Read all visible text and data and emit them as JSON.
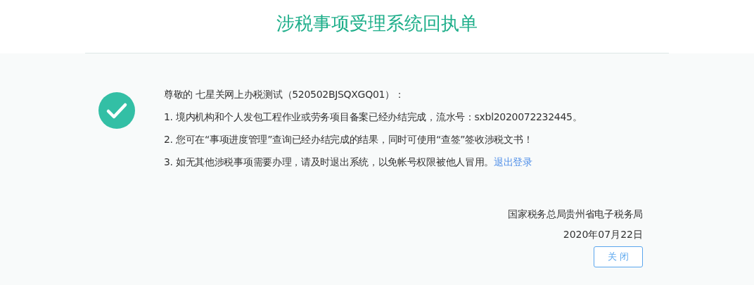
{
  "title": "涉税事项受理系统回执单",
  "greeting": "尊敬的 七星关网上办税测试（520502BJSQXGQ01）：",
  "items": [
    {
      "text": "1. 境内机构和个人发包工程作业或劳务项目备案已经办结完成，流水号：sxbl2020072232445。"
    },
    {
      "text": "2. 您可在“事项进度管理”查询已经办结完成的结果，同时可使用“查签”签收涉税文书！"
    },
    {
      "text": "3. 如无其他涉税事项需要办理，请及时退出系统，以免帐号权限被他人冒用。",
      "link": "退出登录"
    }
  ],
  "issuer": "国家税务总局贵州省电子税务局",
  "date": "2020年07月22日",
  "close_button": "关 闭"
}
